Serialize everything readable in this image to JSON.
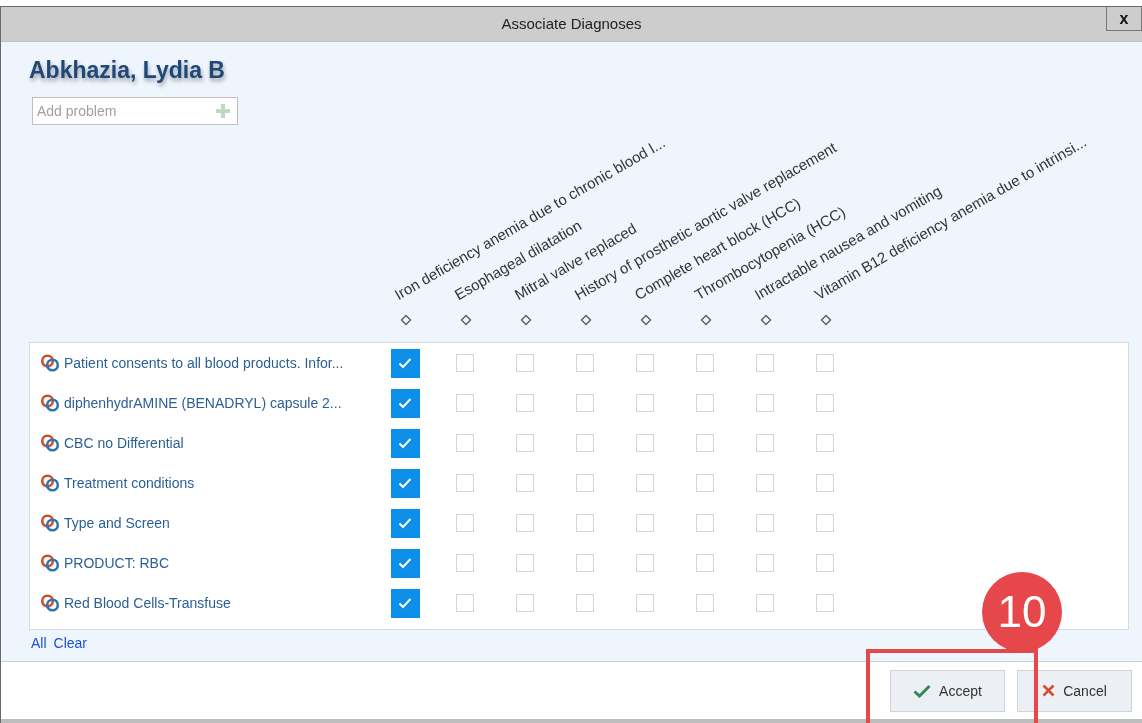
{
  "window": {
    "title": "Associate Diagnoses",
    "close": "x"
  },
  "patient": {
    "name": "Abkhazia, Lydia B"
  },
  "add_problem": {
    "placeholder": "Add problem"
  },
  "columns": [
    {
      "label": "Iron deficiency anemia due to chronic blood l..."
    },
    {
      "label": "Esophageal dilatation"
    },
    {
      "label": "Mitral valve replaced"
    },
    {
      "label": "History of prosthetic aortic valve replacement"
    },
    {
      "label": "Complete heart block (HCC)"
    },
    {
      "label": "Thrombocytopenia (HCC)"
    },
    {
      "label": "Intractable nausea and vomiting"
    },
    {
      "label": "Vitamin B12 deficiency anemia due to intrinsi..."
    }
  ],
  "rows": [
    {
      "label": "Patient consents to all blood products. Infor...",
      "checks": [
        true,
        false,
        false,
        false,
        false,
        false,
        false,
        false
      ]
    },
    {
      "label": "diphenhydrAMINE (BENADRYL) capsule 2...",
      "checks": [
        true,
        false,
        false,
        false,
        false,
        false,
        false,
        false
      ]
    },
    {
      "label": "CBC no Differential",
      "checks": [
        true,
        false,
        false,
        false,
        false,
        false,
        false,
        false
      ]
    },
    {
      "label": "Treatment conditions",
      "checks": [
        true,
        false,
        false,
        false,
        false,
        false,
        false,
        false
      ]
    },
    {
      "label": "Type and Screen",
      "checks": [
        true,
        false,
        false,
        false,
        false,
        false,
        false,
        false
      ]
    },
    {
      "label": "PRODUCT: RBC",
      "checks": [
        true,
        false,
        false,
        false,
        false,
        false,
        false,
        false
      ]
    },
    {
      "label": "Red Blood Cells-Transfuse",
      "checks": [
        true,
        false,
        false,
        false,
        false,
        false,
        false,
        false
      ]
    }
  ],
  "links": [
    "All",
    "Clear"
  ],
  "buttons": [
    {
      "kind": "accept",
      "label": "Accept"
    },
    {
      "kind": "cancel",
      "label": "Cancel"
    }
  ],
  "annotation": {
    "step": "10"
  }
}
